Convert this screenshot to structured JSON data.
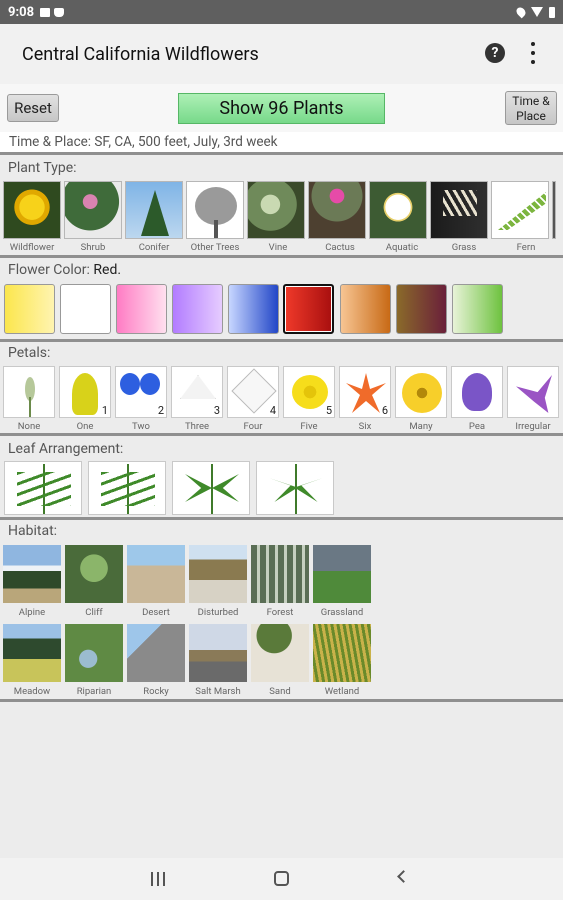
{
  "status": {
    "time": "9:08"
  },
  "app": {
    "title": "Central California Wildflowers"
  },
  "toolbar": {
    "reset": "Reset",
    "show": "Show 96 Plants",
    "time_place_btn": "Time & Place"
  },
  "time_place": "Time & Place: SF, CA, 500 feet, July, 3rd week",
  "plant_type": {
    "label": "Plant Type:",
    "items": [
      "Wildflower",
      "Shrub",
      "Conifer",
      "Other Trees",
      "Vine",
      "Cactus",
      "Aquatic",
      "Grass",
      "Fern"
    ]
  },
  "flower_color": {
    "label": "Flower Color:",
    "selected": "Red."
  },
  "petals": {
    "label": "Petals:",
    "items": [
      "None",
      "One",
      "Two",
      "Three",
      "Four",
      "Five",
      "Six",
      "Many",
      "Pea",
      "Irregular"
    ],
    "counts": [
      "",
      "1",
      "2",
      "3",
      "4",
      "5",
      "6",
      "",
      "",
      ""
    ]
  },
  "leaf": {
    "label": "Leaf Arrangement:"
  },
  "habitat": {
    "label": "Habitat:",
    "row1": [
      "Alpine",
      "Cliff",
      "Desert",
      "Disturbed",
      "Forest",
      "Grassland"
    ],
    "row2": [
      "Meadow",
      "Riparian",
      "Rocky",
      "Salt Marsh",
      "Sand",
      "Wetland"
    ]
  }
}
